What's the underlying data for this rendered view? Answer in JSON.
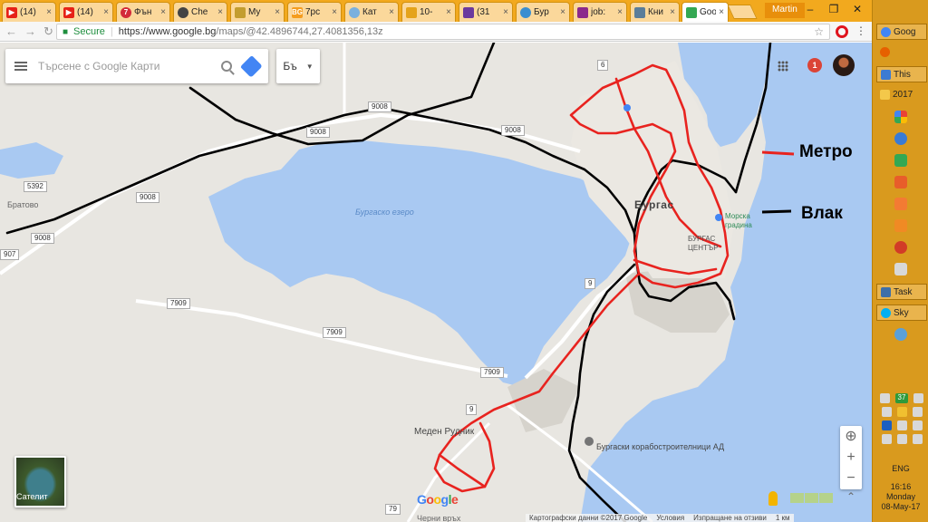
{
  "browser": {
    "tabs": [
      {
        "label": "(14)",
        "icon": "youtube-icon",
        "color": "#e62117"
      },
      {
        "label": "(14)",
        "icon": "youtube-icon",
        "color": "#e62117"
      },
      {
        "label": "Фън",
        "icon": "seven-icon",
        "color": "#d32b3a",
        "glyph": "7"
      },
      {
        "label": "Che",
        "icon": "chess-icon",
        "color": "#444444"
      },
      {
        "label": "My",
        "icon": "folder-icon",
        "color": "#c39d2f"
      },
      {
        "label": "7pc",
        "icon": "bg-icon",
        "color": "#f59d1f",
        "glyph": "BG"
      },
      {
        "label": "Кат",
        "icon": "blue-drop-icon",
        "color": "#7ab0de"
      },
      {
        "label": "10-",
        "icon": "ten-icon",
        "color": "#e5a31a"
      },
      {
        "label": "(31",
        "icon": "mail-icon",
        "color": "#6b3a9e"
      },
      {
        "label": "Бур",
        "icon": "map-pin-icon",
        "color": "#3b8ed0"
      },
      {
        "label": "job:",
        "icon": "job-icon",
        "color": "#8c2a8c"
      },
      {
        "label": "Кни",
        "icon": "book-icon",
        "color": "#5a7d9a"
      },
      {
        "label": "Goo",
        "icon": "google-maps-icon",
        "color": "#34a853"
      }
    ],
    "user_name": "Martin",
    "omnibox": {
      "secure_label": "Secure",
      "url_host": "https://www.google.bg",
      "url_path": "/maps/@42.4896744,27.4081356,13z"
    }
  },
  "map": {
    "search": {
      "placeholder": "Търсене с Google Карти"
    },
    "language_label": "Бъ",
    "notifications_count": "1",
    "legend": {
      "metro_label": "Метро",
      "metro_color": "#e8231f",
      "train_label": "Влак",
      "train_color": "#000000"
    },
    "place_labels": {
      "lake": "Бургаско езеро",
      "city": "Бургас",
      "center_line1": "БУРГАС",
      "center_line2": "ЦЕНТЪР",
      "bratovo": "Братово",
      "meden_rudnik": "Меден Рудник",
      "shipyard": "Бургаски корабостроителници АД",
      "garden_line1": "Морска",
      "garden_line2": "градина",
      "chernivrah": "Черни връх"
    },
    "road_numbers": {
      "r9008a": "9008",
      "r9008b": "9008",
      "r9008c": "9008",
      "r9008d": "9008",
      "r9008e": "9008",
      "r5392": "5392",
      "r7909a": "7909",
      "r7909b": "7909",
      "r7909c": "7909",
      "r907": "907",
      "r6": "6",
      "r9": "9",
      "r79": "79"
    },
    "satellite_label": "Сателит",
    "google_logo": "Google",
    "footer": {
      "map_data": "Картографски данни ©2017 Google",
      "terms": "Условия",
      "feedback": "Изпращане на отзиви",
      "scale": "1 км"
    }
  },
  "taskbar": {
    "items": [
      {
        "label": "Goog",
        "color": "#4285f4"
      },
      {
        "label": "",
        "color": "#e66000"
      },
      {
        "label": "This",
        "color": "#3c7bd2"
      },
      {
        "label": "2017",
        "color": "#f4c84a"
      },
      {
        "label": "Task",
        "color": "#3e6fa8"
      },
      {
        "label": "Sky",
        "color": "#00aff0"
      }
    ],
    "tray_badge": "37",
    "language": "ENG",
    "time": "16:16",
    "day": "Monday",
    "date": "08-May-17"
  }
}
